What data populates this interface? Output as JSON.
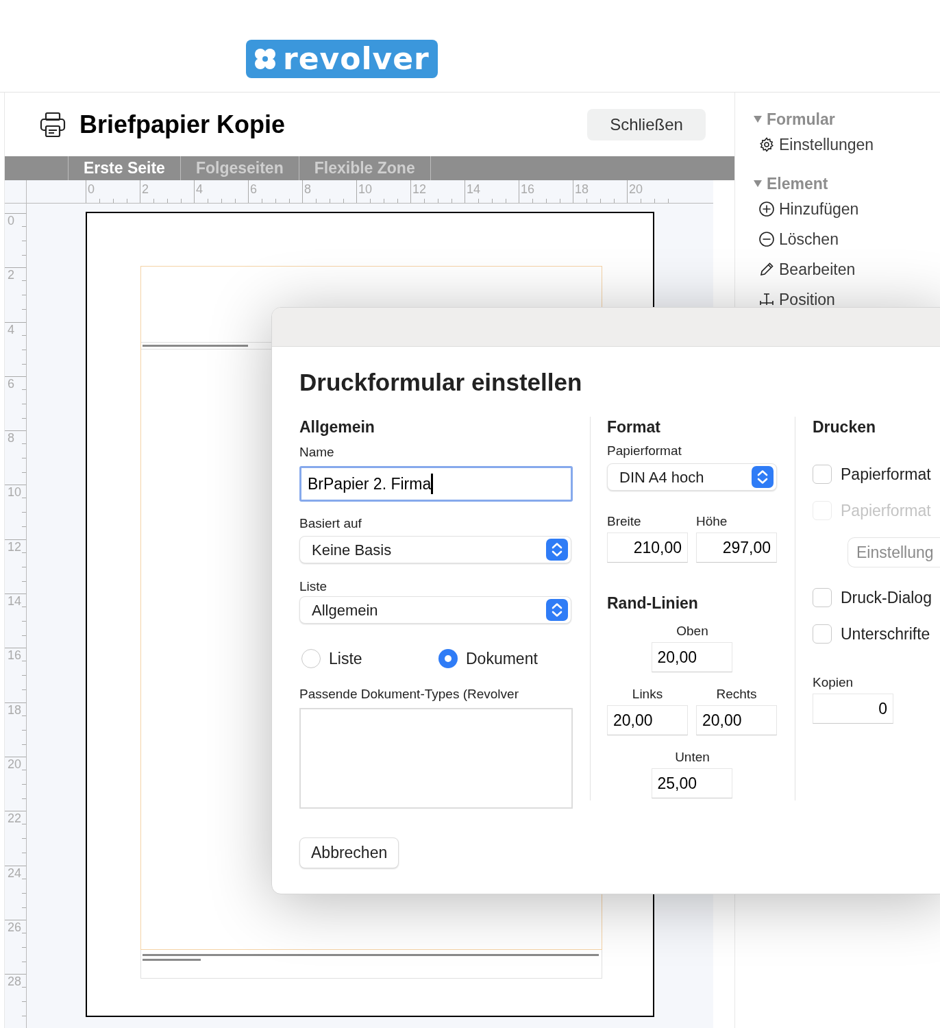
{
  "logo": {
    "text": "revolver"
  },
  "document": {
    "title": "Briefpapier Kopie",
    "close_button": "Schließen"
  },
  "tabs": [
    {
      "label": "Erste Seite",
      "selected": true
    },
    {
      "label": "Folgeseiten",
      "selected": false
    },
    {
      "label": "Flexible Zone",
      "selected": false
    }
  ],
  "ruler": {
    "horizontal": [
      "0",
      "2",
      "4",
      "6",
      "8",
      "10",
      "12",
      "14",
      "16",
      "18",
      "20"
    ],
    "vertical": [
      "0",
      "2",
      "4",
      "6",
      "8",
      "10",
      "12",
      "14",
      "16",
      "18",
      "20",
      "22",
      "24",
      "26",
      "28"
    ]
  },
  "sidebar": {
    "sections": [
      {
        "title": "Formular",
        "expanded": true,
        "items": [
          {
            "kind": "gear",
            "label": "Einstellungen"
          }
        ]
      },
      {
        "title": "Element",
        "expanded": true,
        "items": [
          {
            "kind": "add",
            "label": "Hinzufügen"
          },
          {
            "kind": "remove",
            "label": "Löschen"
          },
          {
            "kind": "edit",
            "label": "Bearbeiten"
          },
          {
            "kind": "position",
            "label": "Position"
          }
        ]
      }
    ]
  },
  "dialog": {
    "title": "Druckformular einstellen",
    "general": {
      "heading": "Allgemein",
      "name_label": "Name",
      "name_value": "BrPapier 2. Firma",
      "name_focused": true,
      "based_on_label": "Basiert auf",
      "based_on_value": "Keine Basis",
      "list_label": "Liste",
      "list_value": "Allgemein",
      "radios": [
        {
          "label": "Liste",
          "selected": false
        },
        {
          "label": "Dokument",
          "selected": true
        }
      ],
      "doc_types_label": "Passende Dokument-Types (Revolver"
    },
    "format": {
      "heading": "Format",
      "paper_label": "Papierformat",
      "paper_value": "DIN A4 hoch",
      "width_label": "Breite",
      "width_value": "210,00",
      "height_label": "Höhe",
      "height_value": "297,00",
      "margins_heading": "Rand-Linien",
      "top_label": "Oben",
      "top_value": "20,00",
      "left_label": "Links",
      "left_value": "20,00",
      "right_label": "Rechts",
      "right_value": "20,00",
      "bottom_label": "Unten",
      "bottom_value": "25,00"
    },
    "print": {
      "heading": "Drucken",
      "options": [
        {
          "kind": "checkbox",
          "label": "Papierformat",
          "checked": false,
          "disabled": false
        },
        {
          "kind": "checkbox",
          "label": "Papierformat",
          "checked": false,
          "disabled": true
        },
        {
          "kind": "button",
          "label": "Einstellung"
        },
        {
          "kind": "checkbox",
          "label": "Druck-Dialog",
          "checked": false,
          "disabled": false
        },
        {
          "kind": "checkbox",
          "label": "Unterschrifte",
          "checked": false,
          "disabled": false
        }
      ],
      "copies_label": "Kopien",
      "copies_value": "0"
    },
    "cancel_button": "Abbrechen"
  }
}
